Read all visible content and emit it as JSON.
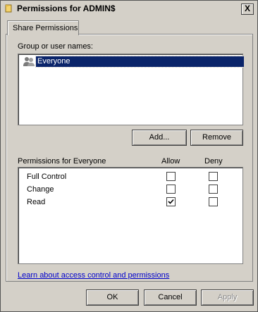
{
  "window": {
    "title": "Permissions for ADMIN$",
    "close_glyph": "X"
  },
  "tabs": [
    {
      "label": "Share Permissions",
      "selected": true
    }
  ],
  "groups": {
    "label": "Group or user names:",
    "items": [
      {
        "name": "Everyone",
        "icon": "users-icon",
        "selected": true
      }
    ]
  },
  "buttons": {
    "add": "Add...",
    "remove": "Remove",
    "ok": "OK",
    "cancel": "Cancel",
    "apply": "Apply"
  },
  "permissions": {
    "header": "Permissions for Everyone",
    "allow_header": "Allow",
    "deny_header": "Deny",
    "rows": [
      {
        "name": "Full Control",
        "allow": false,
        "deny": false
      },
      {
        "name": "Change",
        "allow": false,
        "deny": false
      },
      {
        "name": "Read",
        "allow": true,
        "deny": false
      }
    ]
  },
  "help_link": "Learn about access control and permissions"
}
